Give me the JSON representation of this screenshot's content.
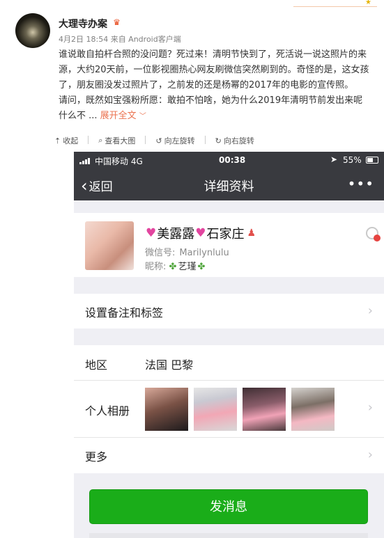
{
  "post": {
    "username": "大理寺办案",
    "vip_icon": "vip-crown-icon",
    "meta": "4月2日 18:54 来自 Android客户端",
    "lines": [
      "谁说敢自拍杆合照的没问题？死过来！清明节快到了，死活说一说这照片的来",
      "源，大约20天前，一位影视圈热心网友刷微信突然刷到的。奇怪的是，这女孩",
      "了，朋友圈没发过照片了，之前发的还是杨幂的2017年的电影的宣传照。",
      "请问，既然如宝强粉所愿：敢拍不怕啥，她为什么2019年清明节前发出来呢"
    ],
    "last_line_prefix": "什么不 ... ",
    "expand_label": "展开全文",
    "expand_arrow": "﹀",
    "actions": [
      {
        "icon": "⇡",
        "label": "收起"
      },
      {
        "icon": "⌕",
        "label": "查看大图"
      },
      {
        "icon": "↺",
        "label": "向左旋转"
      },
      {
        "icon": "↻",
        "label": "向右旋转"
      }
    ]
  },
  "wechat": {
    "status": {
      "carrier": "中国移动  4G",
      "time": "00:38",
      "battery": "55%"
    },
    "nav": {
      "back_label": "返回",
      "back_glyph": "‹",
      "title": "详细资料",
      "more_glyph": "•••"
    },
    "profile": {
      "name": "美露露",
      "location_tag": "石家庄",
      "heart_glyph": "♥",
      "red_glyph": "♟",
      "wxid_label": "微信号:",
      "wxid_value": "Marilynlulu",
      "alias_label": "昵称:",
      "clover_glyph": "✤",
      "alias_value": "艺瑾"
    },
    "rows": {
      "remark_label": "设置备注和标签",
      "region_label": "地区",
      "region_value": "法国 巴黎",
      "album_label": "个人相册",
      "more_label": "更多",
      "arrow_glyph": "›"
    },
    "send_button": "发消息"
  }
}
